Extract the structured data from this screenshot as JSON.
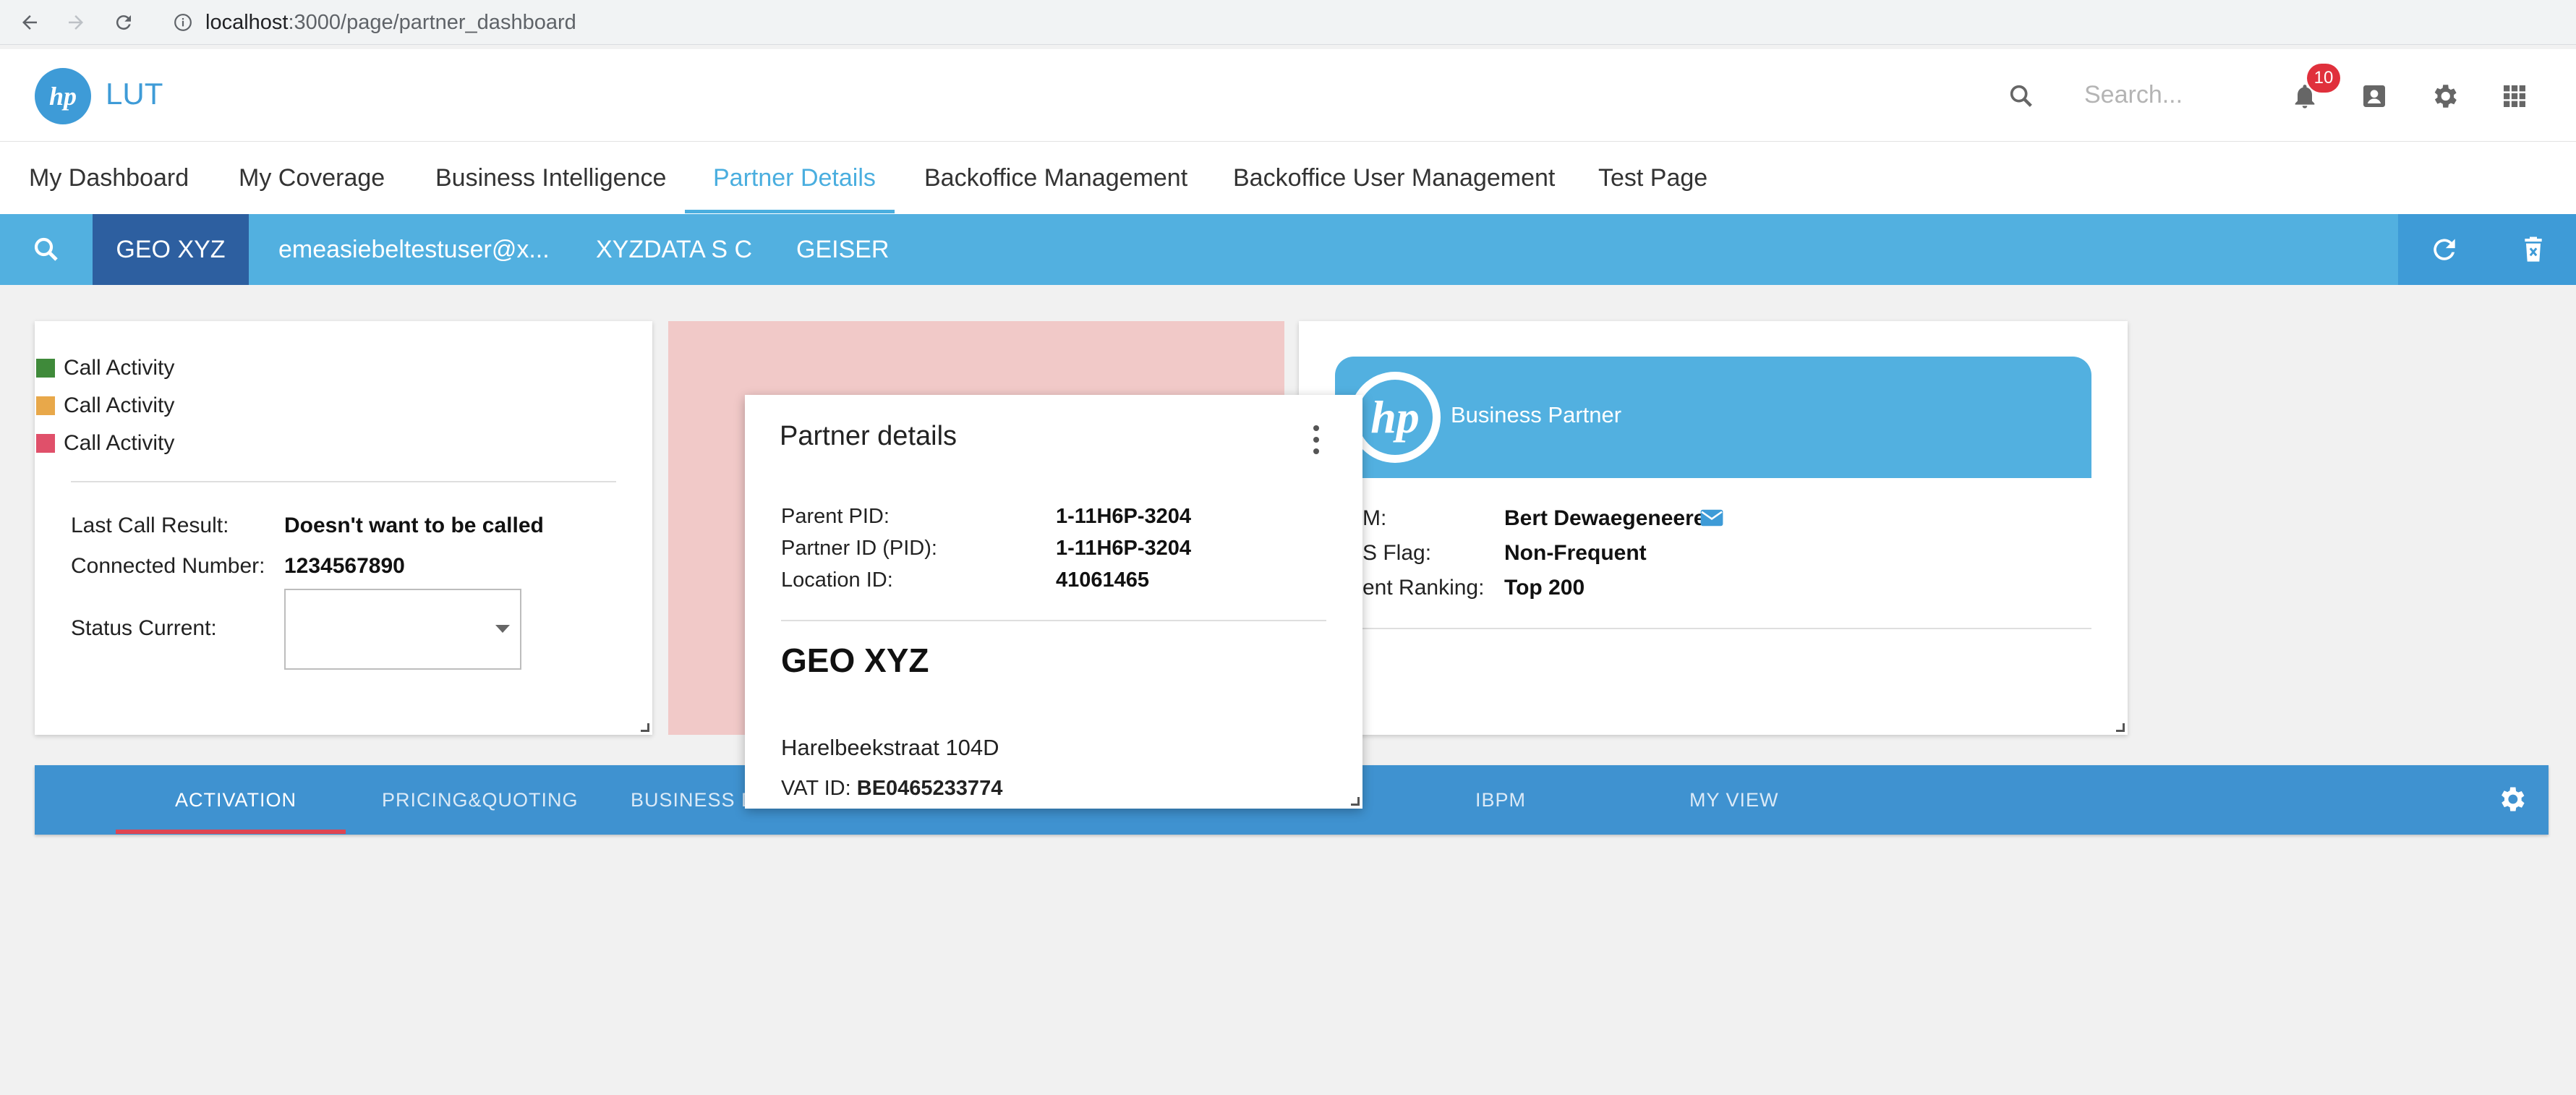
{
  "browser": {
    "url_host": "localhost",
    "url_path": ":3000/page/partner_dashboard"
  },
  "header": {
    "app_name": "LUT",
    "search_placeholder": "Search...",
    "notification_count": "10"
  },
  "main_tabs": [
    {
      "label": "My Dashboard"
    },
    {
      "label": "My Coverage"
    },
    {
      "label": "Business Intelligence"
    },
    {
      "label": "Partner Details"
    },
    {
      "label": "Backoffice Management"
    },
    {
      "label": "Backoffice User Management"
    },
    {
      "label": "Test Page"
    }
  ],
  "active_main_tab": "Partner Details",
  "context_bar": {
    "items": [
      {
        "label": "GEO XYZ"
      },
      {
        "label": "emeasiebeltestuser@x..."
      },
      {
        "label": "XYZDATA S C"
      },
      {
        "label": "GEISER"
      }
    ]
  },
  "call_card": {
    "legend": [
      {
        "label": "Call Activity",
        "color": "#3f8a3a"
      },
      {
        "label": "Call Activity",
        "color": "#e8a84a"
      },
      {
        "label": "Call Activity",
        "color": "#e0506a"
      }
    ],
    "last_call_result_label": "Last Call Result:",
    "last_call_result_value": "Doesn't want to be called",
    "connected_number_label": "Connected Number:",
    "connected_number_value": "1234567890",
    "status_current_label": "Status Current:"
  },
  "business_partner_card": {
    "title": "Business Partner",
    "rows": [
      {
        "label": "M:",
        "value": "Bert Dewaegeneere"
      },
      {
        "label": "S Flag:",
        "value": "Non-Frequent"
      },
      {
        "label": "ent Ranking:",
        "value": "Top 200"
      }
    ]
  },
  "bottom_tabs": [
    {
      "label": "ACTIVATION"
    },
    {
      "label": "PRICING&QUOTING"
    },
    {
      "label": "BUSINESS D"
    },
    {
      "label": "IBPM"
    },
    {
      "label": "MY VIEW"
    }
  ],
  "popup": {
    "title": "Partner details",
    "parent_pid_label": "Parent PID:",
    "parent_pid_value": "1-11H6P-3204",
    "partner_id_label": "Partner ID (PID):",
    "partner_id_value": "1-11H6P-3204",
    "location_id_label": "Location ID:",
    "location_id_value": "41061465",
    "geo": "GEO XYZ",
    "address": "Harelbeekstraat 104D",
    "vat_label": "VAT ID:",
    "vat_value": "BE0465233774"
  },
  "colors": {
    "brand_blue": "#3e9bd7",
    "context_bar": "#52b0e0",
    "context_active": "#2d5fa0",
    "bottom_tabs": "#3f92d0",
    "active_underline": "#e04451",
    "pink_panel": "#f1c9c8"
  }
}
